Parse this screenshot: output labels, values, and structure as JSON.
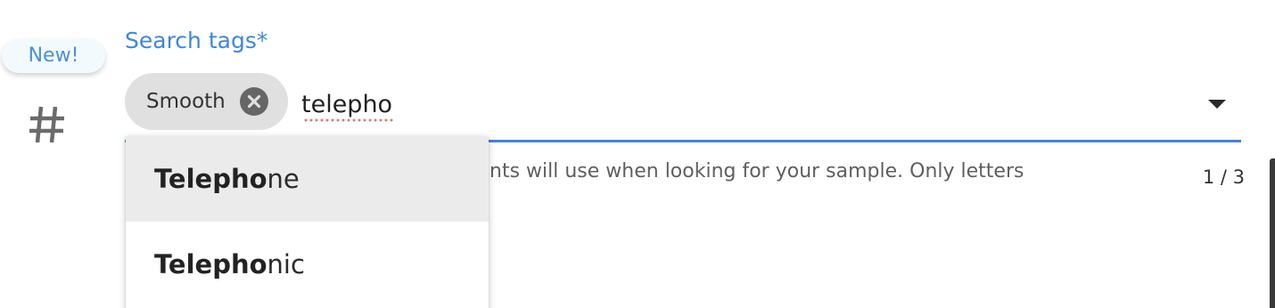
{
  "badge": {
    "label": "New!"
  },
  "field": {
    "label": "Search tags*",
    "input_value": "telepho",
    "helper_text": "nts will use when looking for your sample. Only letters",
    "counter": "1 / 3"
  },
  "chips": [
    {
      "label": "Smooth"
    }
  ],
  "suggestions": [
    {
      "match": "Telepho",
      "rest": "ne"
    },
    {
      "match": "Telepho",
      "rest": "nic"
    }
  ],
  "colors": {
    "accent": "#3f86d9",
    "chip_bg": "#e0e0e0",
    "highlight_bg": "#ebebeb",
    "spellcheck": "#e57373"
  },
  "icons": {
    "left_icon": "hash-icon",
    "chip_remove": "close-circle-icon",
    "dropdown": "caret-down-icon"
  }
}
